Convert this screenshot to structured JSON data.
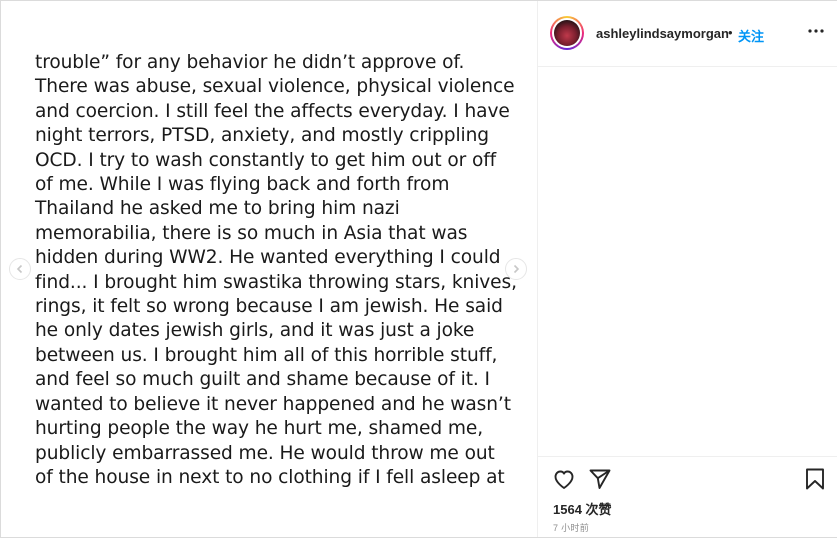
{
  "post": {
    "lines": [
      "trouble” for any behavior he didn’t approve of.",
      "There was abuse, sexual violence, physical violence",
      "and coercion. I still feel the affects everyday. I have",
      "night terrors, PTSD, anxiety, and mostly crippling",
      "OCD. I try to wash constantly to get him out or off",
      "of me. While I was flying back and forth from",
      "Thailand he asked me to bring him nazi",
      "memorabilia, there is so much in Asia that was",
      "hidden during WW2. He wanted everything I could",
      "find... I brought him swastika throwing stars, knives,",
      "rings, it felt so wrong because I am jewish. He said",
      "he only dates jewish girls, and it was just a joke",
      "between us. I brought him all of this horrible stuff,",
      "and feel so much guilt and shame because of it. I",
      "wanted to believe it never happened and he wasn’t",
      "hurting people the way he hurt me, shamed me,",
      "publicly embarrassed me. He would throw me out",
      "of the house in next to no clothing if I fell asleep at"
    ]
  },
  "header": {
    "username": "ashleylindsaymorgan",
    "separator": "•",
    "follow_label": "关注"
  },
  "actions": {
    "likes": "1564 次赞",
    "time": "7 小时前"
  },
  "icons": {
    "prev": "chevron-left-icon",
    "next": "chevron-right-icon",
    "more": "more-horizontal-icon",
    "like": "heart-icon",
    "share": "paper-plane-icon",
    "save": "bookmark-icon"
  },
  "colors": {
    "accent": "#0095f6",
    "text": "#262626",
    "muted": "#8e8e8e"
  }
}
